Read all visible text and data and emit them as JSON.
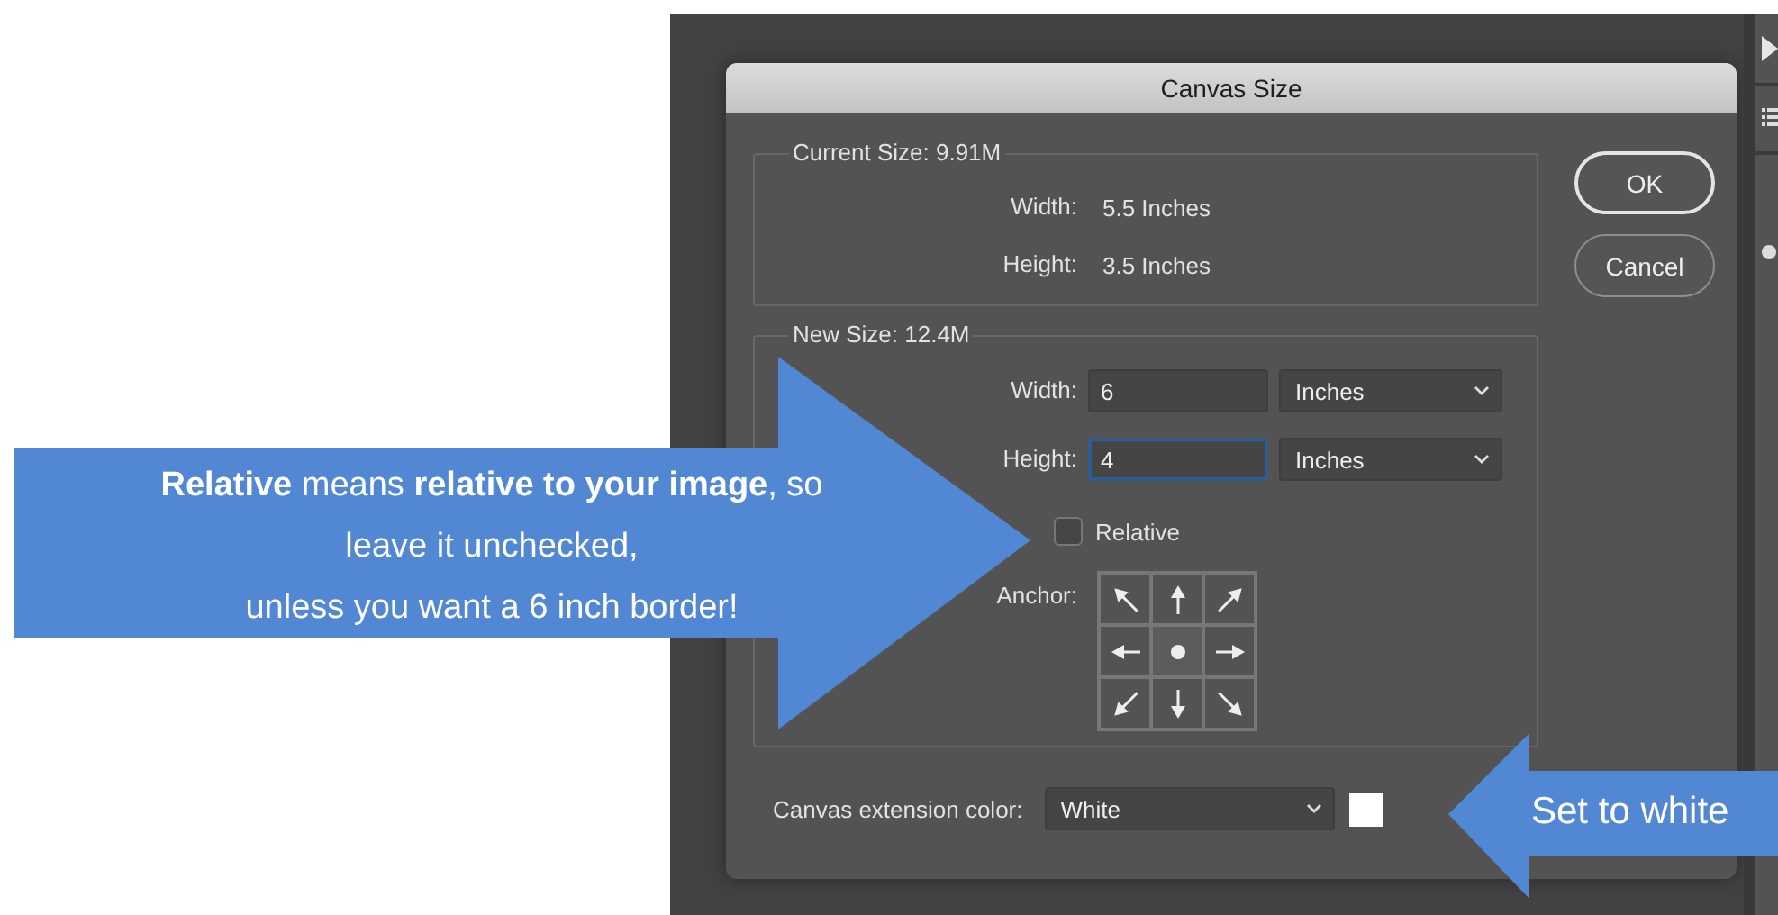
{
  "dialog": {
    "title": "Canvas Size",
    "current_size": {
      "legend": "Current Size: 9.91M",
      "rows": [
        {
          "label": "Width:",
          "value": "5.5 Inches"
        },
        {
          "label": "Height:",
          "value": "3.5 Inches"
        }
      ]
    },
    "new_size": {
      "legend": "New Size: 12.4M",
      "rows": [
        {
          "label": "Width:",
          "value": "6",
          "unit": "Inches",
          "focused": false
        },
        {
          "label": "Height:",
          "value": "4",
          "unit": "Inches",
          "focused": true
        }
      ],
      "relative": {
        "label": "Relative",
        "checked": false
      },
      "anchor": {
        "label": "Anchor:",
        "cells": [
          {
            "selected": false
          },
          {
            "selected": false
          },
          {
            "selected": false
          },
          {
            "selected": false
          },
          {
            "selected": true
          },
          {
            "selected": false
          },
          {
            "selected": false
          },
          {
            "selected": false
          },
          {
            "selected": false
          }
        ]
      }
    },
    "extension_color": {
      "label": "Canvas extension color:",
      "value": "White"
    },
    "buttons": [
      {
        "label": "OK",
        "default": true
      },
      {
        "label": "Cancel",
        "default": false
      }
    ]
  },
  "callouts": [
    {
      "kind": "point-right",
      "lines": [
        "**Relative** means **relative to your image**, so",
        "leave it unchecked,",
        "unless you want a 6 inch border!"
      ]
    },
    {
      "kind": "point-left",
      "lines": [
        "Set to white"
      ]
    }
  ]
}
